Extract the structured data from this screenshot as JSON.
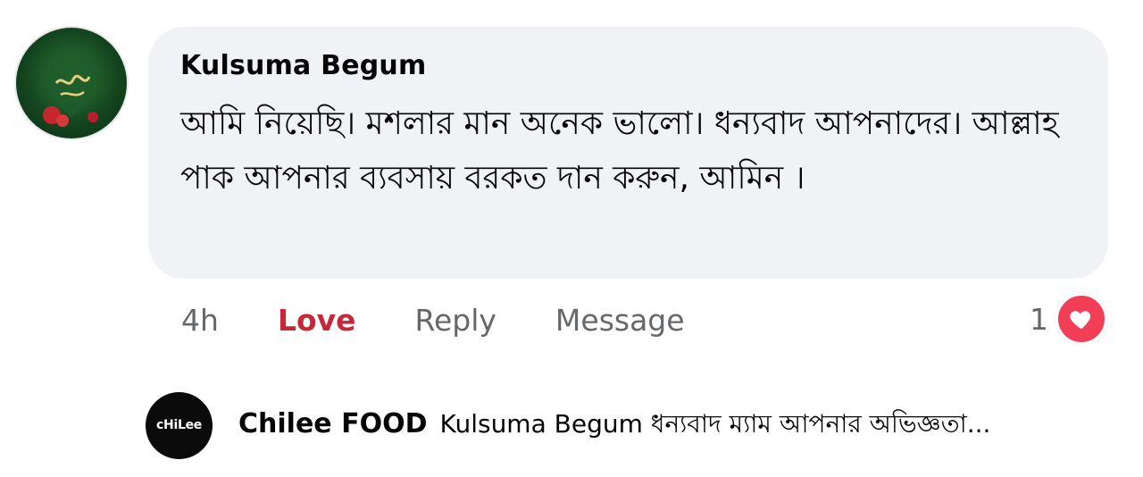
{
  "comment": {
    "author": "Kulsuma Begum",
    "text": "আমি নিয়েছি। মশলার মান অনেক ভালো। ধন্যবাদ আপনাদের। আল্লাহ পাক আপনার ব্যবসায় বরকত দান করুন, আমিন ।",
    "time": "4h",
    "actions": {
      "love": "Love",
      "reply": "Reply",
      "message": "Message"
    },
    "reaction": {
      "count": "1",
      "icon": "heart-icon",
      "color": "#f33e58"
    }
  },
  "reply": {
    "author": "Chilee FOOD",
    "text": "Kulsuma Begum ধন্যবাদ ম্যাম আপনার অভিজ্ঞতা...",
    "avatar_logo": "cHiLee"
  },
  "colors": {
    "bubble": "#f0f2f5",
    "love_active": "#c6283a",
    "secondary_text": "#65676b"
  }
}
